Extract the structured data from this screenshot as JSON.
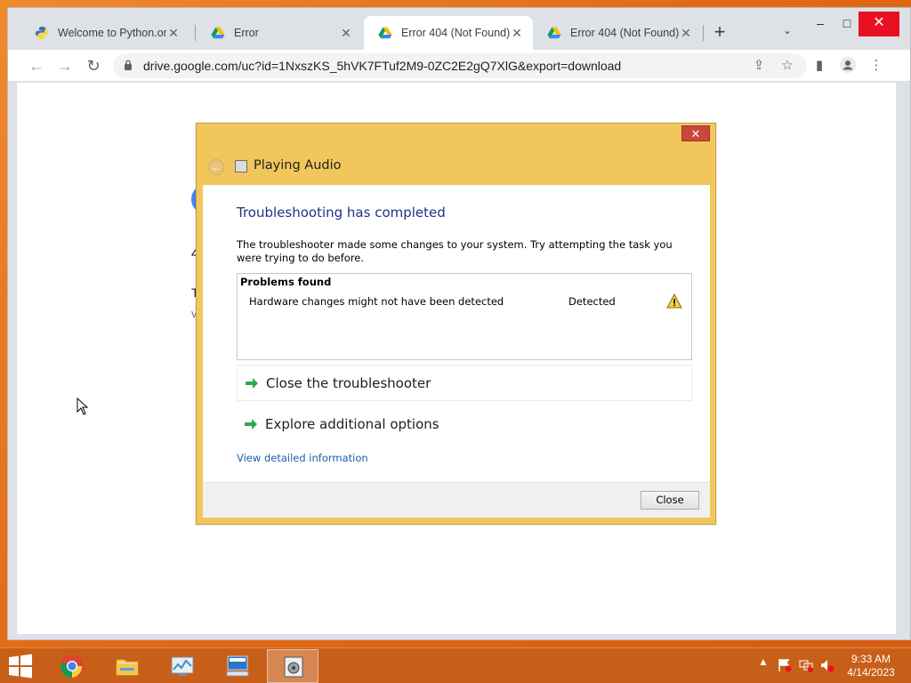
{
  "browser": {
    "tabs": [
      {
        "title": "Welcome to Python.org",
        "favicon": "python-icon",
        "active": false
      },
      {
        "title": "Error",
        "favicon": "google-drive-icon",
        "active": false
      },
      {
        "title": "Error 404 (Not Found)!!",
        "favicon": "google-drive-icon",
        "active": true
      },
      {
        "title": "Error 404 (Not Found)!!",
        "favicon": "google-drive-icon",
        "active": false
      }
    ],
    "url": "drive.google.com/uc?id=1NxszKS_5hVK7FTuf2M9-0ZC2E2gQ7XlG&export=download",
    "new_tab_label": "+",
    "window_controls": {
      "minimize": "–",
      "maximize": "□",
      "close": "✕"
    }
  },
  "page_fragments": {
    "line1": "4",
    "line2": "T",
    "line3": "v"
  },
  "dialog": {
    "title": "Playing Audio",
    "close_label": "✕",
    "heading": "Troubleshooting has completed",
    "description": "The troubleshooter made some changes to your system. Try attempting the task you were trying to do before.",
    "problems_header": "Problems found",
    "problems": [
      {
        "name": "Hardware changes might not have been detected",
        "status": "Detected",
        "icon": "warning-icon"
      }
    ],
    "options": [
      {
        "label": "Close the troubleshooter",
        "icon": "green-arrow-icon"
      },
      {
        "label": "Explore additional options",
        "icon": "green-arrow-icon"
      }
    ],
    "link": "View detailed information",
    "close_button": "Close"
  },
  "taskbar": {
    "apps": [
      "chrome-icon",
      "file-explorer-icon",
      "performance-monitor-icon",
      "remote-desktop-icon",
      "troubleshooter-icon"
    ],
    "time": "9:33 AM",
    "date": "4/14/2023"
  },
  "colors": {
    "dialog_frame": "#f1c75c",
    "heading_blue": "#1e3287",
    "link_blue": "#1c5fa8",
    "taskbar": "#c85f18",
    "close_red": "#e81123"
  }
}
